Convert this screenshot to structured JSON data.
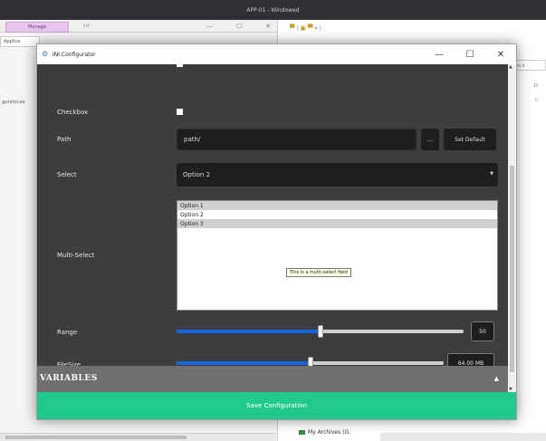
{
  "top_titlebar": {
    "title": "APP-01 - Windowed"
  },
  "background": {
    "manage_tab": "Manage",
    "txt_tab": "txt",
    "applic_tab": "Applica",
    "left_label": "gurator.ex",
    "window_controls": [
      "—",
      "☐",
      "✕"
    ],
    "right_search": "jects II",
    "right_d": "D",
    "right_tc": "TC",
    "archives_label": "My Archives (G:"
  },
  "dialog": {
    "title": "INI Configurator",
    "controls": {
      "minimize": "—",
      "maximize": "☐",
      "close": "✕"
    },
    "fields": {
      "checkbox_label": "Checkbox",
      "checkbox_checked": false,
      "path_label": "Path",
      "path_value": "path/",
      "browse_label": "...",
      "set_default_label": "Set Default",
      "select_label": "Select",
      "select_value": "Option 2",
      "multiselect_label": "Multi-Select",
      "multiselect_options": [
        {
          "label": "Option 1",
          "selected": true
        },
        {
          "label": "Option 2",
          "selected": false
        },
        {
          "label": "Option 3",
          "selected": true
        }
      ],
      "multiselect_tooltip": "This is a multi-select field",
      "range_label": "Range",
      "range_value": "50",
      "range_fraction": 0.5,
      "filesize_label": "FileSize",
      "filesize_value": "64.00 MB",
      "filesize_fraction": 0.5
    },
    "variables_section": {
      "title": "VARIABLES",
      "caret": "▲"
    },
    "save_button": "Save Configuration"
  },
  "colors": {
    "panel_bg": "#3d3d3d",
    "input_bg": "#1e1e1e",
    "accent_slider": "#1565e0",
    "save_button": "#22c98d",
    "variables_bar": "#6f6f6f"
  }
}
